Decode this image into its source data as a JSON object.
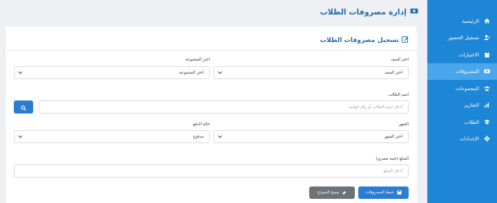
{
  "page": {
    "title": "إدارة مصروفات الطلاب"
  },
  "sidebar": {
    "items": [
      {
        "label": "الرئيسية",
        "icon": "home-icon"
      },
      {
        "label": "تسجيل الحضور",
        "icon": "user-check-icon"
      },
      {
        "label": "الاختبارات",
        "icon": "clipboard-icon"
      },
      {
        "label": "المصروفات",
        "icon": "money-icon",
        "active": true
      },
      {
        "label": "المجموعات",
        "icon": "users-icon"
      },
      {
        "label": "التقارير",
        "icon": "chart-icon"
      },
      {
        "label": "الطلاب",
        "icon": "student-icon"
      },
      {
        "label": "الإعدادات",
        "icon": "gear-icon"
      }
    ]
  },
  "form": {
    "title": "تسجيل مصروفات الطلاب",
    "grade_label": "اختر الصف",
    "grade_value": "اختر الصف",
    "group_label": "اختر المجموعة",
    "group_value": "اختر المجموعة",
    "student_label": "اسم الطالب",
    "student_placeholder": "أدخل اسم الطالب أو رقم الهاتف",
    "month_label": "الشهر",
    "month_value": "اختر الشهر",
    "payment_status_label": "حالة الدفع",
    "payment_status_value": "مدفوع",
    "amount_label": "المبلغ (جنيه مصري)",
    "amount_placeholder": "أدخل المبلغ",
    "save_label": "حفظ المصروفات",
    "clear_label": "مسح النموذج"
  },
  "colors": {
    "sidebar": "#1e86d6",
    "accent": "#2b7cd3",
    "title": "#1f6bb1"
  }
}
